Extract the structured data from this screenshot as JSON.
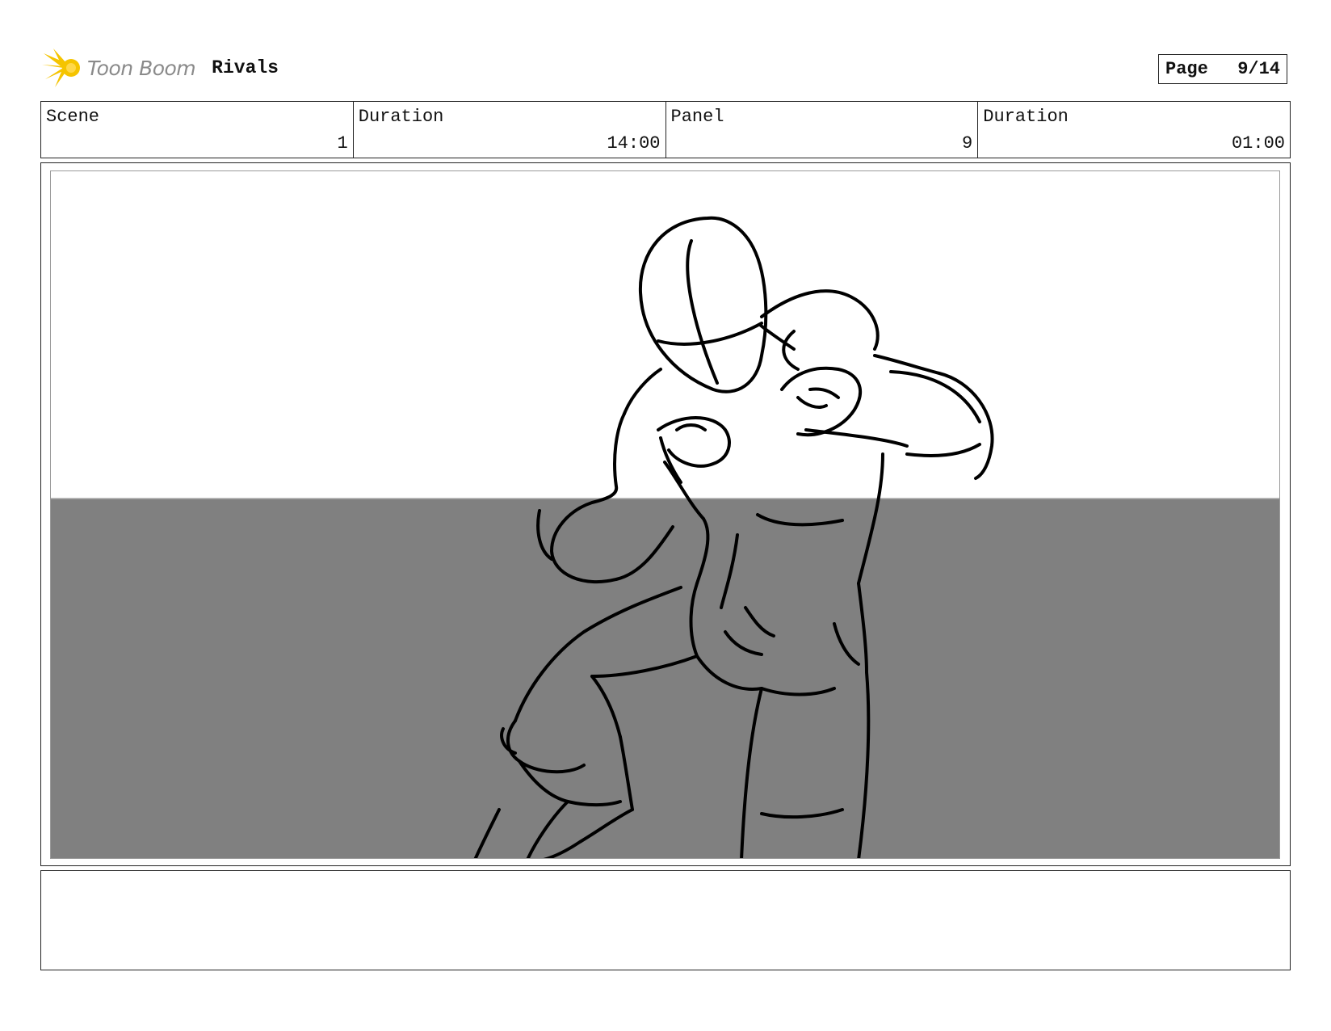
{
  "header": {
    "brand_name": "Toon Boom",
    "project_title": "Rivals",
    "page_label": "Page",
    "page_value": "9/14"
  },
  "info": [
    {
      "label": "Scene",
      "value": "1"
    },
    {
      "label": "Duration",
      "value": "14:00"
    },
    {
      "label": "Panel",
      "value": "9"
    },
    {
      "label": "Duration",
      "value": "01:00"
    }
  ],
  "notes": {
    "text": ""
  },
  "colors": {
    "floor": "#808080",
    "logo": "#f5c400",
    "border": "#222222"
  },
  "icons": {
    "logo": "toon-boom-logo-icon"
  }
}
